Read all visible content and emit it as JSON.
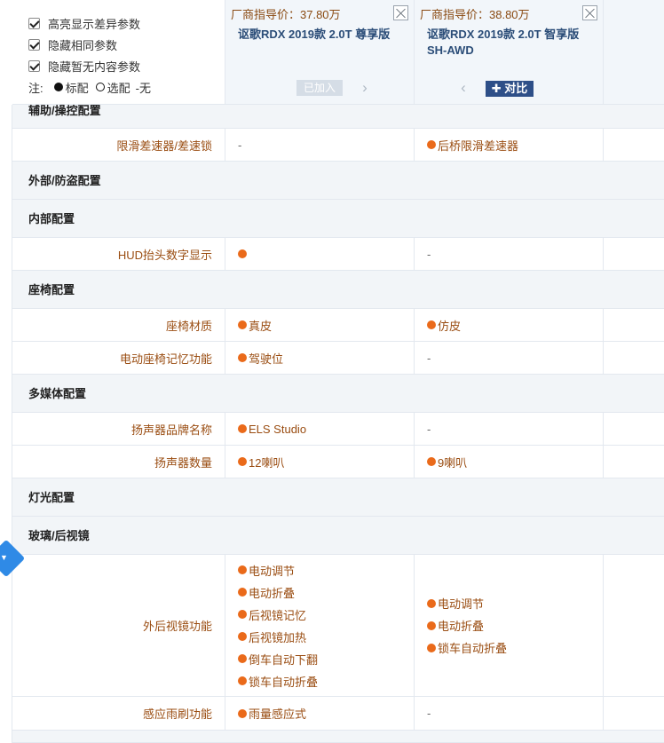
{
  "options": [
    {
      "label": "高亮显示差异参数",
      "checked": true
    },
    {
      "label": "隐藏相同参数",
      "checked": true
    },
    {
      "label": "隐藏暂无内容参数",
      "checked": true
    }
  ],
  "legend": {
    "prefix": "注:",
    "standard": "标配",
    "optional": "选配",
    "none": "-无"
  },
  "cars": [
    {
      "price": "厂商指导价：37.80万",
      "name": "讴歌RDX 2019款 2.0T 尊享版",
      "action": "已加入"
    },
    {
      "price": "厂商指导价：38.80万",
      "name": "讴歌RDX 2019款 2.0T 智享版SH-AWD",
      "action": "✚ 对比"
    }
  ],
  "partial_section": "辅助/操控配置",
  "sections": {
    "exterior": "外部/防盗配置",
    "interior": "内部配置",
    "seat": "座椅配置",
    "media": "多媒体配置",
    "light": "灯光配置",
    "glass": "玻璃/后视镜"
  },
  "rows": {
    "lsd": {
      "label": "限滑差速器/差速锁",
      "a": "-",
      "b": "后桥限滑差速器"
    },
    "hud": {
      "label": "HUD抬头数字显示",
      "a": "",
      "b": "-"
    },
    "seat_material": {
      "label": "座椅材质",
      "a": "真皮",
      "b": "仿皮"
    },
    "seat_memory": {
      "label": "电动座椅记忆功能",
      "a": "驾驶位",
      "b": "-"
    },
    "speaker_brand": {
      "label": "扬声器品牌名称",
      "a": "ELS Studio",
      "b": "-"
    },
    "speaker_count": {
      "label": "扬声器数量",
      "a": "12喇叭",
      "b": "9喇叭"
    },
    "mirror": {
      "label": "外后视镜功能",
      "a": [
        "电动调节",
        "电动折叠",
        "后视镜记忆",
        "后视镜加热",
        "倒车自动下翻",
        "锁车自动折叠"
      ],
      "b": [
        "电动调节",
        "电动折叠",
        "锁车自动折叠"
      ]
    },
    "rain": {
      "label": "感应雨刷功能",
      "a": "雨量感应式",
      "b": "-"
    }
  },
  "colors": {
    "value": "#9a4d12",
    "dot": "#ea6a1a",
    "section_bg": "#f2f5f8",
    "compare_btn": "#2e4f88"
  }
}
